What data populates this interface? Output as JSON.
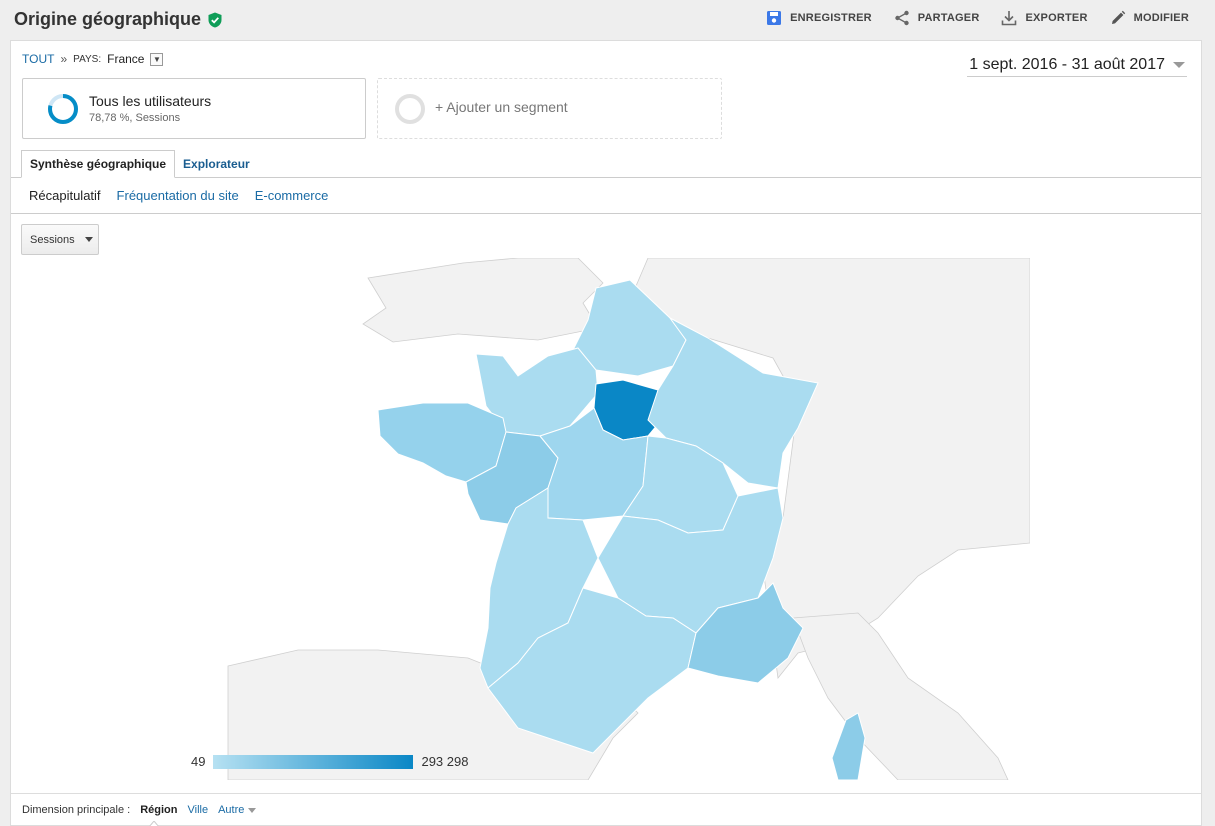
{
  "header": {
    "title": "Origine géographique",
    "actions": {
      "save": "ENREGISTRER",
      "share": "PARTAGER",
      "export": "EXPORTER",
      "edit": "MODIFIER"
    }
  },
  "breadcrumb": {
    "root": "TOUT",
    "separator": "»",
    "label": "PAYS:",
    "value": "France"
  },
  "date_range": "1 sept. 2016 - 31 août 2017",
  "segment": {
    "title": "Tous les utilisateurs",
    "subtitle": "78,78 %, Sessions",
    "add_label": "+ Ajouter un segment"
  },
  "tabs": [
    "Synthèse géographique",
    "Explorateur"
  ],
  "subnav": {
    "selected": "Récapitulatif",
    "links": [
      "Fréquentation du site",
      "E-commerce"
    ]
  },
  "metric": "Sessions",
  "legend": {
    "min": "49",
    "max": "293 298"
  },
  "dimension": {
    "label": "Dimension principale :",
    "current": "Région",
    "links": [
      "Ville",
      "Autre"
    ]
  },
  "colors": {
    "accent": "#1a6ba5",
    "save_icon": "#3b78e7",
    "verified": "#0f9d58",
    "region_light": "#aadcf0",
    "region_mid": "#8ccce8",
    "region_dark": "#0a87c6"
  }
}
